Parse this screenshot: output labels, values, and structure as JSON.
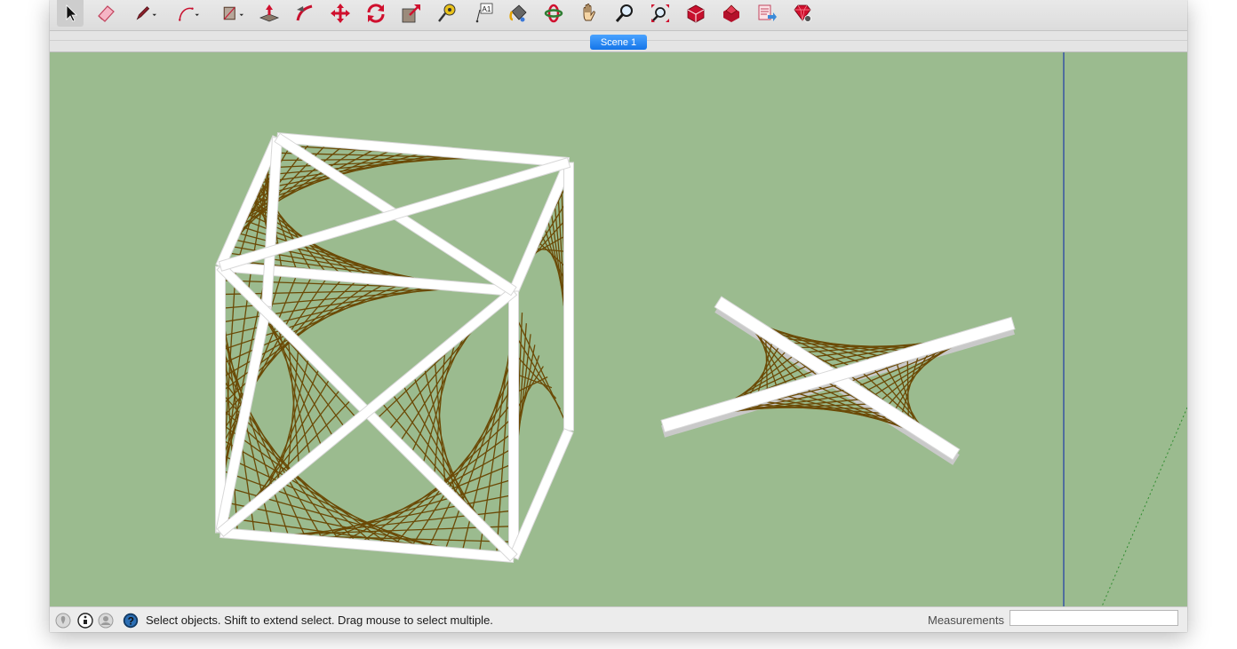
{
  "toolbar": {
    "tools": [
      {
        "name": "select-tool",
        "icon": "arrow-cursor-icon",
        "selected": true
      },
      {
        "name": "eraser-tool",
        "icon": "eraser-icon"
      },
      {
        "name": "pencil-tool",
        "icon": "pencil-icon",
        "dropdown": true
      },
      {
        "name": "arc-tool",
        "icon": "arc-icon",
        "dropdown": true
      },
      {
        "name": "shapes-tool",
        "icon": "rectangle-icon",
        "dropdown": true
      },
      {
        "name": "push-pull-tool",
        "icon": "push-pull-icon"
      },
      {
        "name": "follow-me-tool",
        "icon": "follow-me-icon"
      },
      {
        "name": "move-tool",
        "icon": "move-icon"
      },
      {
        "name": "rotate-tool",
        "icon": "rotate-icon"
      },
      {
        "name": "scale-tool",
        "icon": "scale-icon"
      },
      {
        "name": "tape-measure-tool",
        "icon": "tape-measure-icon"
      },
      {
        "name": "text-tool",
        "icon": "text-icon",
        "label": "A1"
      },
      {
        "name": "paint-bucket-tool",
        "icon": "paint-bucket-icon"
      },
      {
        "name": "orbit-tool",
        "icon": "orbit-icon"
      },
      {
        "name": "pan-tool",
        "icon": "hand-icon"
      },
      {
        "name": "zoom-tool",
        "icon": "magnifier-icon"
      },
      {
        "name": "zoom-extents-tool",
        "icon": "zoom-extents-icon"
      },
      {
        "name": "warehouse-tool",
        "icon": "3d-warehouse-icon"
      },
      {
        "name": "extension-warehouse-tool",
        "icon": "extension-warehouse-icon"
      },
      {
        "name": "send-to-layout-tool",
        "icon": "send-to-layout-icon"
      },
      {
        "name": "extension-manager-tool",
        "icon": "ruby-gem-icon"
      }
    ]
  },
  "scenes": {
    "tabs": [
      {
        "label": "Scene 1",
        "active": true
      }
    ]
  },
  "viewport": {
    "background_color": "#9bbb8f",
    "frame_color": "#ffffff",
    "string_color": "#6b4a06",
    "blue_axis_color": "#1f3ca8",
    "green_axis_color": "#2e8b2e"
  },
  "statusbar": {
    "icons": [
      "geo-location-icon",
      "credits-icon",
      "account-icon",
      "help-icon"
    ],
    "message": "Select objects. Shift to extend select. Drag mouse to select multiple.",
    "measurements_label": "Measurements",
    "measurements_value": ""
  }
}
